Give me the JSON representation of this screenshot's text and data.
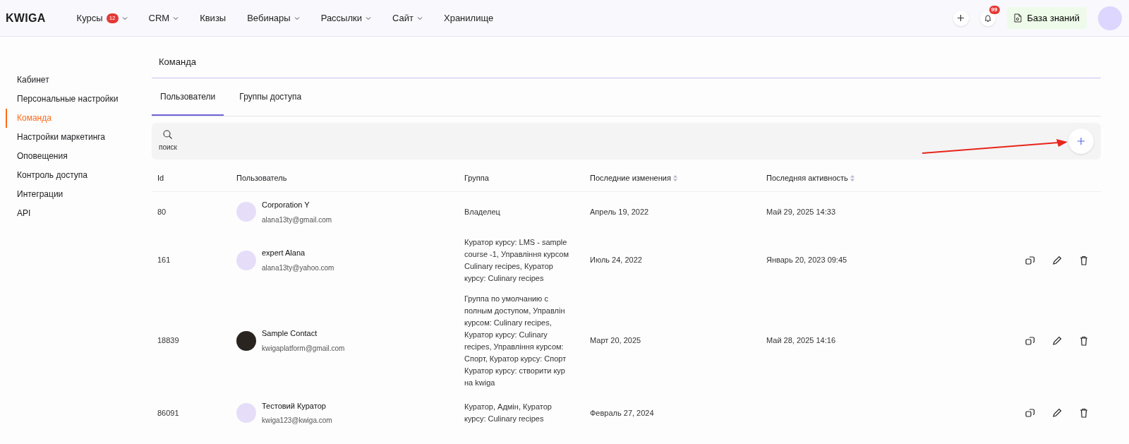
{
  "header": {
    "logo": "KWIGA",
    "nav": [
      {
        "label": "Курсы",
        "badge": "12",
        "dropdown": true
      },
      {
        "label": "CRM",
        "dropdown": true
      },
      {
        "label": "Квизы",
        "dropdown": false
      },
      {
        "label": "Вебинары",
        "dropdown": true
      },
      {
        "label": "Рассылки",
        "dropdown": true
      },
      {
        "label": "Сайт",
        "dropdown": true
      },
      {
        "label": "Хранилище",
        "dropdown": false
      }
    ],
    "notifications_badge": "99",
    "knowledge_base": "База знаний"
  },
  "sidebar": {
    "items": [
      {
        "label": "Кабинет",
        "selected": false
      },
      {
        "label": "Персональные настройки",
        "selected": false
      },
      {
        "label": "Команда",
        "selected": true
      },
      {
        "label": "Настройки маркетинга",
        "selected": false
      },
      {
        "label": "Оповещения",
        "selected": false
      },
      {
        "label": "Контроль доступа",
        "selected": false
      },
      {
        "label": "Интеграции",
        "selected": false
      },
      {
        "label": "API",
        "selected": false
      }
    ]
  },
  "page_title": "Команда",
  "tabs": [
    {
      "label": "Пользователи",
      "selected": true
    },
    {
      "label": "Группы доступа",
      "selected": false
    }
  ],
  "search": {
    "label": "поиск"
  },
  "table": {
    "columns": [
      {
        "label": "Id",
        "sortable": false
      },
      {
        "label": "Пользователь",
        "sortable": false
      },
      {
        "label": "Группа",
        "sortable": false
      },
      {
        "label": "Последние изменения",
        "sortable": true
      },
      {
        "label": "Последняя активность",
        "sortable": true
      }
    ],
    "rows": [
      {
        "id": "80",
        "name": "Corporation Y",
        "email": "alana13ty@gmail.com",
        "kind": "illustration",
        "group": [
          "Владелец"
        ],
        "changed": "Апрель 19, 2022",
        "activity": "Май 29, 2025 14:33",
        "actions": false
      },
      {
        "id": "161",
        "name": "expert Alana",
        "email": "alana13ty@yahoo.com",
        "kind": "illustration",
        "group": [
          "Куратор курсу: LMS - sample",
          "course -1, Управління курсом",
          "Culinary recipes, Куратор",
          "курсу: Culinary recipes"
        ],
        "changed": "Июль 24, 2022",
        "activity": "Январь 20, 2023 09:45",
        "actions": true
      },
      {
        "id": "18839",
        "name": "Sample Contact",
        "email": "kwigaplatform@gmail.com",
        "kind": "photo",
        "group": [
          "Группа по умолчанию с",
          "полным доступом, Управлін",
          "курсом: Culinary recipes,",
          "Куратор курсу: Culinary",
          "recipes, Управління курсом:",
          "Спорт, Куратор курсу: Спорт",
          "Куратор курсу: створити кур",
          "на kwiga"
        ],
        "changed": "Март 20, 2025",
        "activity": "Май 28, 2025 14:16",
        "actions": true
      },
      {
        "id": "86091",
        "name": "Тестовий Куратор",
        "email": "kwiga123@kwiga.com",
        "kind": "illustration",
        "group": [
          "Куратор, Адмін, Куратор",
          "курсу: Culinary recipes"
        ],
        "changed": "Февраль 27, 2024",
        "actions": true
      }
    ]
  }
}
